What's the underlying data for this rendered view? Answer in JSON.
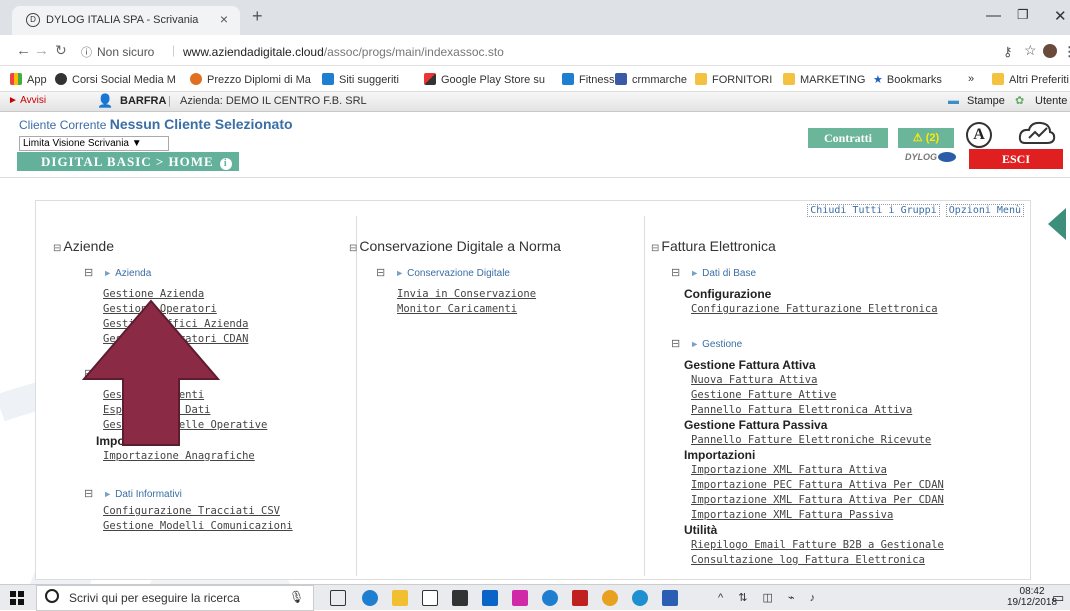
{
  "browser": {
    "tab_title": "DYLOG ITALIA SPA - Scrivania",
    "tab_close": "×",
    "new_tab": "+",
    "not_secure": "Non sicuro",
    "url_domain": "www.aziendadigitale.cloud",
    "url_path": "/assoc/progs/main/indexassoc.sto",
    "bookmarks": [
      "App",
      "Corsi Social Media M",
      "Prezzo Diplomi di Ma",
      "Siti suggeriti",
      "Google Play Store su",
      "Fitness",
      "crmmarche",
      "FORNITORI",
      "MARKETING",
      "Bookmarks"
    ],
    "other_bookmarks": "Altri Preferiti",
    "overflow": "»"
  },
  "app": {
    "avvisi": "Avvisi",
    "user": "BARFRA",
    "azienda": "Azienda: DEMO IL CENTRO F.B. SRL",
    "stampe": "Stampe",
    "utente": "Utente",
    "cliente_label": "Cliente Corrente",
    "cliente_value": "Nessun Cliente Selezionato",
    "limita": "Limita Visione Scrivania",
    "breadcrumb": "DIGITAL BASIC > HOME",
    "contratti": "Contratti",
    "alert_count": "(2)",
    "esci": "ESCI",
    "dylog": "DYLOG"
  },
  "toplinks": [
    "Chiudi Tutti i Gruppi",
    "Opzioni Menù"
  ],
  "col1": {
    "title": "Aziende",
    "group1": "Azienda",
    "links1": [
      "Gestione Azienda",
      "Gestione Operatori",
      "Gestione Uffici Azienda",
      "Gestione Operatori CDAN"
    ],
    "links2": [
      "Gestione Clienti",
      "Esportazione Dati",
      "Gestione Tabelle Operative"
    ],
    "sub_import": "Importazioni",
    "link_import": "Importazione Anagrafiche",
    "group3": "Dati Informativi",
    "links3": [
      "Configurazione Tracciati CSV",
      "Gestione Modelli Comunicazioni"
    ]
  },
  "col2": {
    "title": "Conservazione Digitale a Norma",
    "group": "Conservazione Digitale",
    "links": [
      "Invia in Conservazione",
      "Monitor Caricamenti"
    ]
  },
  "col3": {
    "title": "Fattura Elettronica",
    "group1": "Dati di Base",
    "sub1": "Configurazione",
    "link1": "Configurazione Fatturazione Elettronica",
    "group2": "Gestione",
    "sub_attiva": "Gestione Fattura Attiva",
    "attiva": [
      "Nuova Fattura Attiva",
      "Gestione Fatture Attive",
      "Pannello Fattura Elettronica Attiva"
    ],
    "sub_passiva": "Gestione Fattura Passiva",
    "passiva": [
      "Pannello Fatture Elettroniche Ricevute"
    ],
    "sub_import": "Importazioni",
    "imports": [
      "Importazione XML Fattura Attiva",
      "Importazione PEC Fattura Attiva Per CDAN",
      "Importazione XML Fattura Attiva Per CDAN",
      "Importazione XML Fattura Passiva"
    ],
    "sub_util": "Utilità",
    "util": [
      "Riepilogo Email Fatture B2B a Gestionale",
      "Consultazione log Fattura Elettronica"
    ]
  },
  "taskbar": {
    "search_placeholder": "Scrivi qui per eseguire la ricerca",
    "time": "08:42",
    "date": "19/12/2018"
  },
  "colors": {
    "accent_green": "#63b09b",
    "exit_red": "#e02020",
    "arrow": "#8b2a45",
    "link_blue": "#3a6ea5"
  }
}
